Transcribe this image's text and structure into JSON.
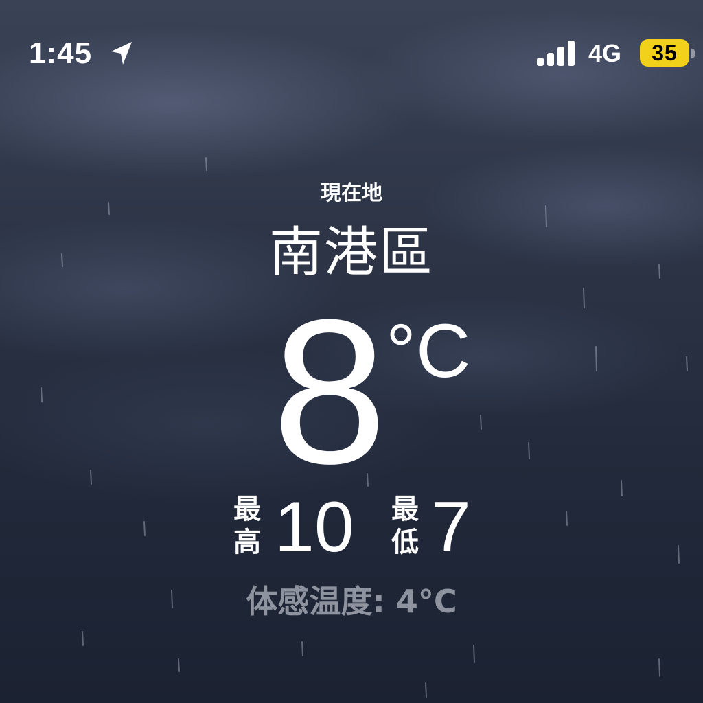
{
  "status_bar": {
    "time": "1:45",
    "location_icon": "location-arrow-icon",
    "signal_icon": "signal-bars-icon",
    "signal_bars": 4,
    "network": "4G",
    "battery": "35",
    "battery_color": "#f2d11a"
  },
  "weather": {
    "caption": "現在地",
    "city": "南港區",
    "temperature": "8",
    "unit": "°C",
    "high_label_1": "最",
    "high_label_2": "高",
    "high": "10",
    "low_label_1": "最",
    "low_label_2": "低",
    "low": "7",
    "feels_like": "体感温度: 4°C"
  },
  "background": {
    "condition": "rain",
    "sky_color": "#2c3446"
  }
}
